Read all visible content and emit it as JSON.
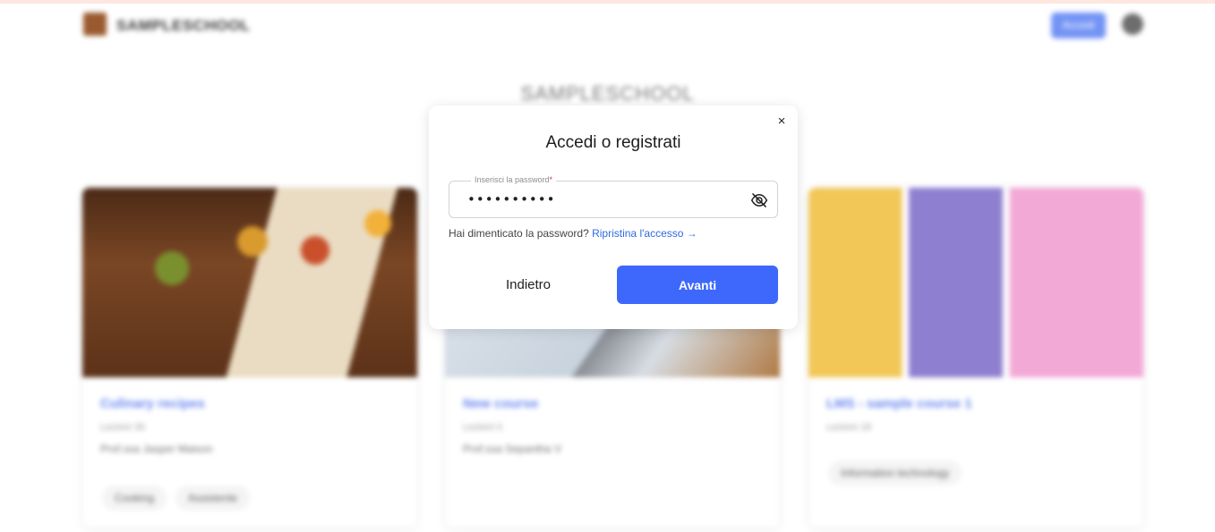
{
  "header": {
    "logo_text": "SAMPLESCHOOL",
    "action_label": "Accedi"
  },
  "school_title": "SAMPLESCHOOL",
  "courses": [
    {
      "title": "Culinary recipes",
      "meta": "Lezioni 30",
      "author": "Prof.ssa Jasper Maison",
      "tags": [
        "Cooking",
        "Assistente"
      ]
    },
    {
      "title": "New course",
      "meta": "Lezioni 0",
      "author": "Prof.ssa Sepantha V",
      "tags": []
    },
    {
      "title": "LMS - sample course 1",
      "meta": "Lezioni 18",
      "author": "",
      "tags": [
        "Information technology"
      ]
    }
  ],
  "modal": {
    "title": "Accedi o registrati",
    "password_label": "Inserisci la password",
    "required_mark": "*",
    "password_value": "••••••••••",
    "forgot_text": "Hai dimenticato la password?",
    "reset_link": "Ripristina l'accesso →",
    "back_label": "Indietro",
    "next_label": "Avanti",
    "close_label": "×"
  },
  "colors": {
    "primary": "#3d68fb",
    "link": "#2f6be0",
    "required": "#d43c3c"
  }
}
